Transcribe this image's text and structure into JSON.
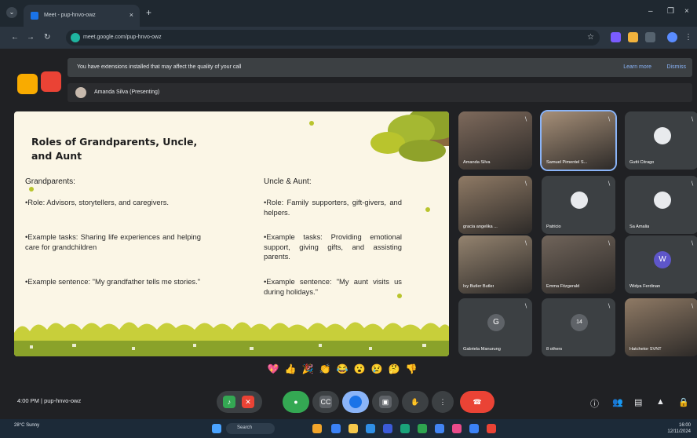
{
  "browser": {
    "tab_title": "Meet - pup-hnvo-owz",
    "url": "meet.google.com/pup-hnvo-owz",
    "colors": {
      "tabbar": "#1f2830",
      "toolbar": "#2b3540"
    }
  },
  "banner": {
    "message": "You have extensions installed that may affect the quality of your call",
    "learn_more": "Learn more",
    "dismiss": "Dismiss"
  },
  "presenter": {
    "label": "Amanda Silva (Presenting)"
  },
  "slide": {
    "title": "Roles of Grandparents, Uncle, and Aunt",
    "left": {
      "heading": "Grandparents:",
      "role": "•Role: Advisors, storytellers, and caregivers.",
      "tasks": "•Example tasks: Sharing life experiences and helping care for grandchildren",
      "sentence": "•Example sentence: \"My grandfather tells me stories.\""
    },
    "right": {
      "heading": "Uncle & Aunt:",
      "role": "•Role: Family supporters, gift-givers, and helpers.",
      "tasks": "•Example tasks: Providing emotional support, giving gifts, and assisting parents.",
      "sentence": "•Example sentence: \"My aunt visits us during holidays.\""
    }
  },
  "participants": [
    {
      "name": "Amanda Silva",
      "type": "photo"
    },
    {
      "name": "Samuel Pimentel S...",
      "type": "photo"
    },
    {
      "name": "Gutti Citrago",
      "type": "avatar"
    },
    {
      "name": "gracia angelika ...",
      "type": "photo"
    },
    {
      "name": "Patricio",
      "type": "avatar"
    },
    {
      "name": "Sa Amalia",
      "type": "avatar"
    },
    {
      "name": "Ivy Butler Butler",
      "type": "photo"
    },
    {
      "name": "Emma Fitzgerald",
      "type": "photo"
    },
    {
      "name": "Widya Ferdinan",
      "type": "letter",
      "letter": "W"
    },
    {
      "name": "Gabriela Manurung",
      "type": "letter",
      "letter": "G"
    },
    {
      "name": "8 others",
      "type": "others",
      "count": "14"
    },
    {
      "name": "Hatchetor SVNT",
      "type": "photo"
    }
  ],
  "reactions": [
    "💖",
    "👍",
    "🎉",
    "👏",
    "😂",
    "😮",
    "😢",
    "🤔",
    "👎"
  ],
  "meeting": {
    "time": "4:00 PM",
    "separator": "|",
    "code": "pup-hnvo-owz"
  },
  "taskbar": {
    "weather_temp": "28°C",
    "weather_desc": "Sunny",
    "search_placeholder": "Search",
    "time": "16:00",
    "date": "12/11/2024"
  }
}
